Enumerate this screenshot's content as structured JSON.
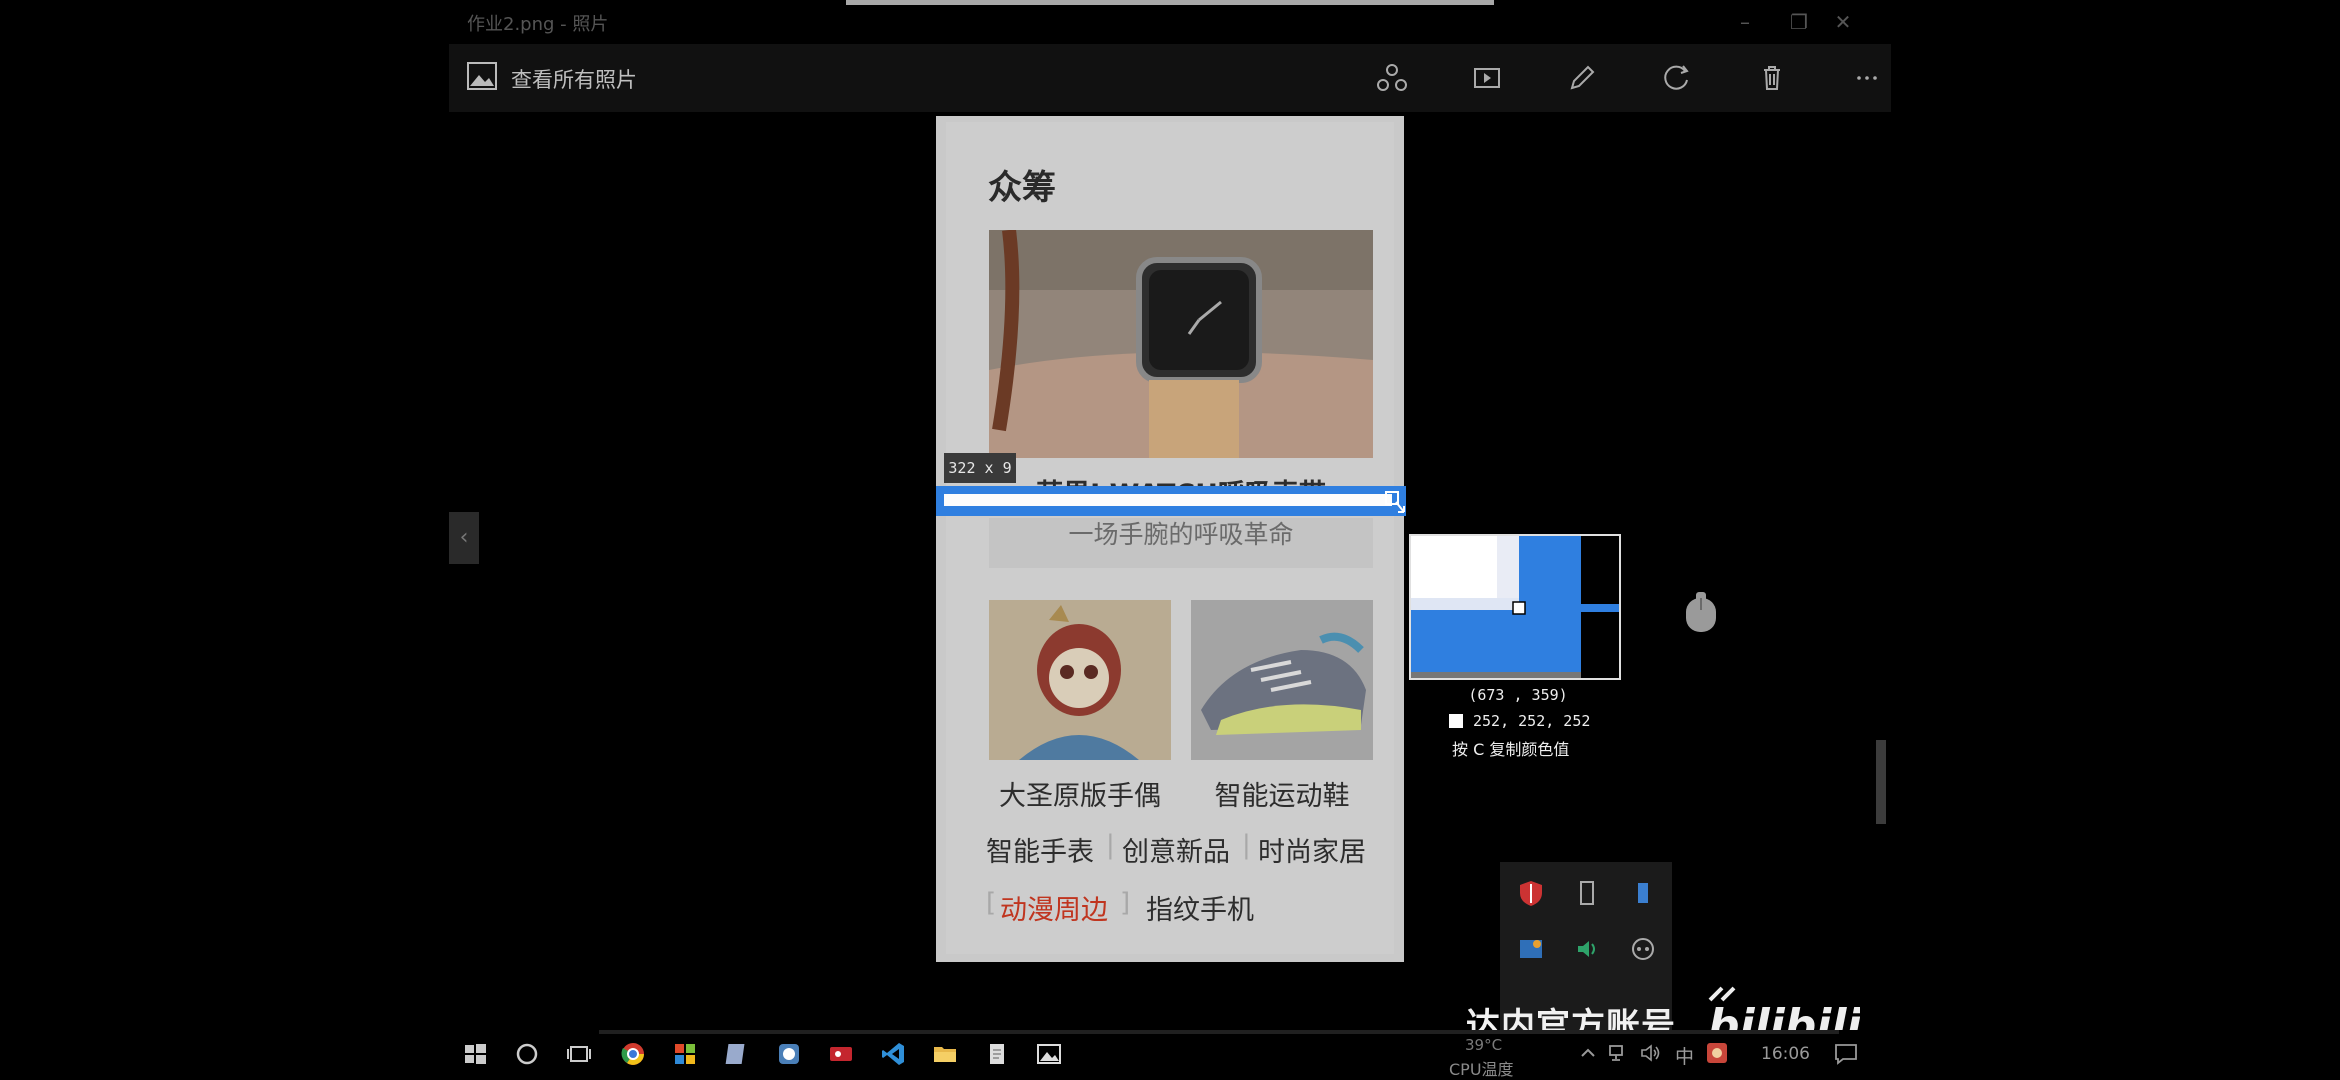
{
  "window": {
    "title": "作业2.png - 照片",
    "controls": [
      "minimize-icon",
      "restore-icon",
      "close-icon"
    ]
  },
  "toolbar": {
    "view_all_label": "查看所有照片",
    "buttons": [
      "share-icon",
      "slideshow-icon",
      "edit-icon",
      "rotate-icon",
      "delete-icon",
      "more-icon"
    ]
  },
  "nav": {
    "prev_glyph": "‹"
  },
  "phone_page": {
    "title": "众筹",
    "hero_title": "苹果I WATCH呼吸表带",
    "hero_subtitle": "一场手腕的呼吸革命",
    "cards": [
      {
        "label": "大圣原版手偶"
      },
      {
        "label": "智能运动鞋"
      }
    ],
    "tags_row1": [
      "智能手表",
      "创意新品",
      "时尚家居"
    ],
    "tags_row2": [
      "动漫周边",
      "指纹手机"
    ],
    "hot_color": "#c0351f"
  },
  "ruler": {
    "size_label": "322 x 9",
    "accent": "#2f7fe0"
  },
  "magnifier": {
    "coords": "(673 , 359)",
    "rgb": "252, 252, 252",
    "hint": "按 C 复制颜色值"
  },
  "watermark": {
    "text": "达内官方账号"
  },
  "taskbar": {
    "cpu_temp": "39°C",
    "cpu_label": "CPU温度",
    "ime": "中",
    "time": "16:06"
  }
}
